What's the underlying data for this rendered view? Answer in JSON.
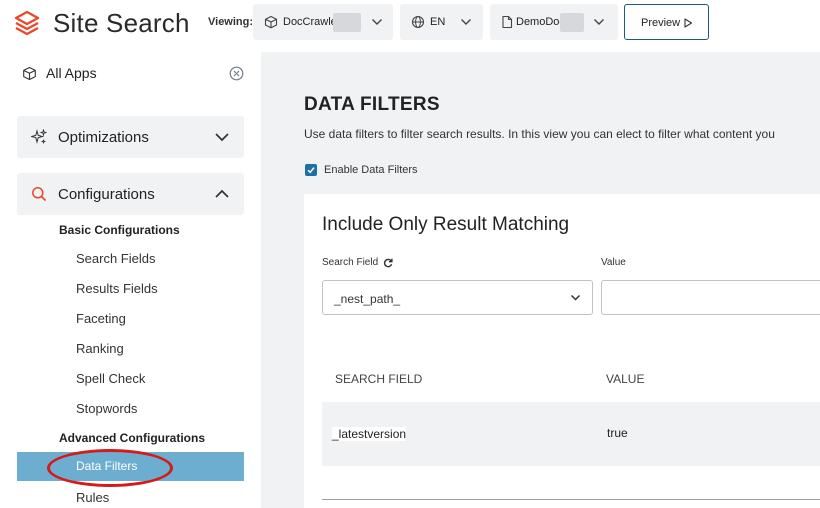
{
  "header": {
    "app_title": "Site Search",
    "viewing_label": "Viewing:",
    "crawler_select": {
      "value": "DocCrawler",
      "icon": "cube-icon"
    },
    "language_select": {
      "value": "EN",
      "icon": "globe-icon"
    },
    "document_select": {
      "value": "DemoDoc",
      "icon": "document-icon"
    },
    "preview_label": "Preview",
    "colors": {
      "brand": "#e8492a",
      "preview_border": "#1d5a78"
    }
  },
  "sidebar": {
    "all_apps_label": "All Apps",
    "optimizations_label": "Optimizations",
    "configurations_label": "Configurations",
    "basic_group_label": "Basic Configurations",
    "basic_items": [
      "Search Fields",
      "Results Fields",
      "Faceting",
      "Ranking",
      "Spell Check",
      "Stopwords"
    ],
    "advanced_group_label": "Advanced Configurations",
    "active_item_label": "Data Filters",
    "after_items": [
      "Rules"
    ],
    "colors": {
      "active_bg": "#6cadd0",
      "annotation": "#d51a1a"
    }
  },
  "main": {
    "title": "DATA FILTERS",
    "description": "Use data filters to filter search results. In this view you can elect to filter what content you",
    "enable_checkbox_label": "Enable Data Filters",
    "enable_checked": true,
    "card": {
      "title": "Include Only Result Matching",
      "search_field_label": "Search Field",
      "value_label": "Value",
      "search_field_value": "_nest_path_",
      "value_input_value": "",
      "table": {
        "headers": [
          "SEARCH FIELD",
          "VALUE"
        ],
        "rows": [
          {
            "field": "_latestversion",
            "value": "true"
          }
        ]
      }
    }
  }
}
